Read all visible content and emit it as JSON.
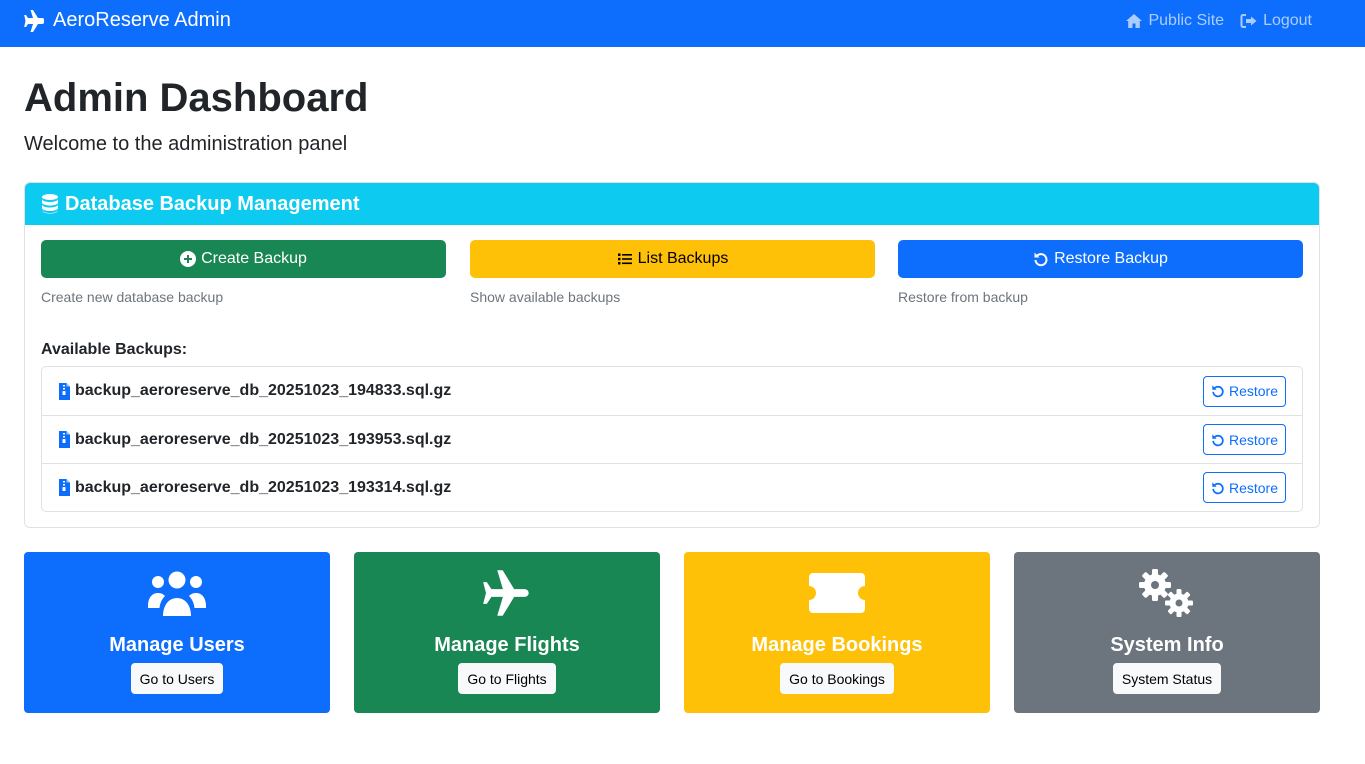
{
  "navbar": {
    "brand": "AeroReserve Admin",
    "brand_icon": "plane-icon",
    "links": [
      {
        "label": "Public Site",
        "icon": "home-icon"
      },
      {
        "label": "Logout",
        "icon": "logout-icon"
      }
    ]
  },
  "header": {
    "title": "Admin Dashboard",
    "subtitle": "Welcome to the administration panel"
  },
  "backup_card": {
    "title": "Database Backup Management",
    "icon": "database-icon",
    "actions": [
      {
        "label": "Create Backup",
        "description": "Create new database backup",
        "icon": "plus-circle-icon",
        "color": "#198754"
      },
      {
        "label": "List Backups",
        "description": "Show available backups",
        "icon": "list-icon",
        "color": "#ffc107"
      },
      {
        "label": "Restore Backup",
        "description": "Restore from backup",
        "icon": "restore-icon",
        "color": "#0d6efd"
      }
    ],
    "available_label": "Available Backups:",
    "backups": [
      {
        "name": "backup_aeroreserve_db_20251023_194833.sql.gz",
        "button": "Restore"
      },
      {
        "name": "backup_aeroreserve_db_20251023_193953.sql.gz",
        "button": "Restore"
      },
      {
        "name": "backup_aeroreserve_db_20251023_193314.sql.gz",
        "button": "Restore"
      }
    ]
  },
  "tiles": [
    {
      "title": "Manage Users",
      "button": "Go to Users",
      "icon": "users-icon",
      "color": "#0d6efd"
    },
    {
      "title": "Manage Flights",
      "button": "Go to Flights",
      "icon": "plane-icon",
      "color": "#198754"
    },
    {
      "title": "Manage Bookings",
      "button": "Go to Bookings",
      "icon": "ticket-icon",
      "color": "#ffc107"
    },
    {
      "title": "System Info",
      "button": "System Status",
      "icon": "gears-icon",
      "color": "#6c757d"
    }
  ],
  "colors": {
    "primary": "#0d6efd",
    "info": "#0dcaf0",
    "success": "#198754",
    "warning": "#ffc107",
    "secondary": "#6c757d"
  }
}
